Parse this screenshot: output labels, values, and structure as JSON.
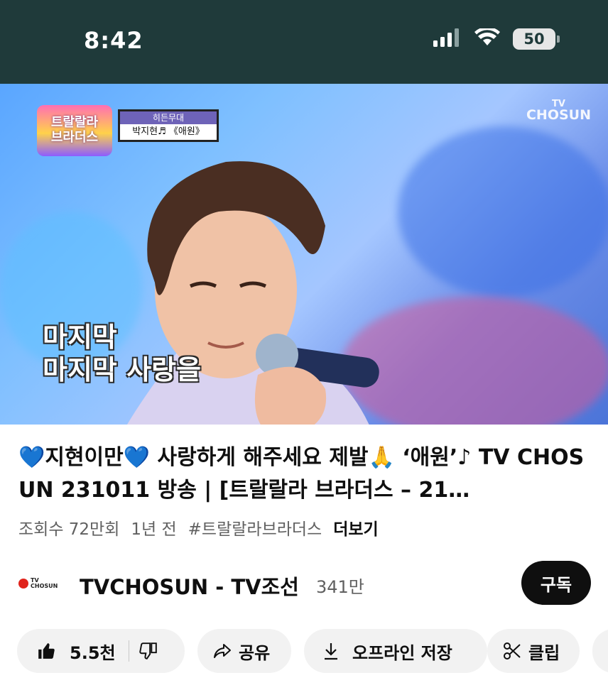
{
  "status_bar": {
    "time": "8:42",
    "battery": "50",
    "icons": [
      "signal-icon",
      "wifi-icon",
      "battery-icon"
    ]
  },
  "video": {
    "show_logo_line1": "트랄랄라",
    "show_logo_line2": "브라더스",
    "stage_card_top": "히든무대",
    "stage_card_bottom": "박지현♬ 《애원》",
    "tv_badge_line1": "TV",
    "tv_badge_line2": "CHOSUN",
    "subtitle_line1": "마지막",
    "subtitle_line2": "마지막 사랑을"
  },
  "title": "💙지현이만💙 사랑하게 해주세요 제발🙏 ‘애원’♪ TV CHOSUN 231011 방송 | [트랄랄라 브라더스 – 21…",
  "meta": {
    "views": "조회수 72만회",
    "age": "1년 전",
    "hashtag": "#트랄랄라브라더스",
    "more": "더보기"
  },
  "channel": {
    "logo_text_tv": "TV",
    "logo_text_name": "CHOSUN",
    "name": "TVCHOSUN - TV조선",
    "subscribers": "341만",
    "subscribe_label": "구독"
  },
  "actions": {
    "likes": "5.5천",
    "share": "공유",
    "download": "오프라인 저장",
    "clip": "클립"
  },
  "colors": {
    "status_bar_bg": "#1f3a3a",
    "subscribe_bg": "#0f0f0f",
    "chip_bg": "#f2f2f2",
    "brand_red": "#e0231b"
  }
}
